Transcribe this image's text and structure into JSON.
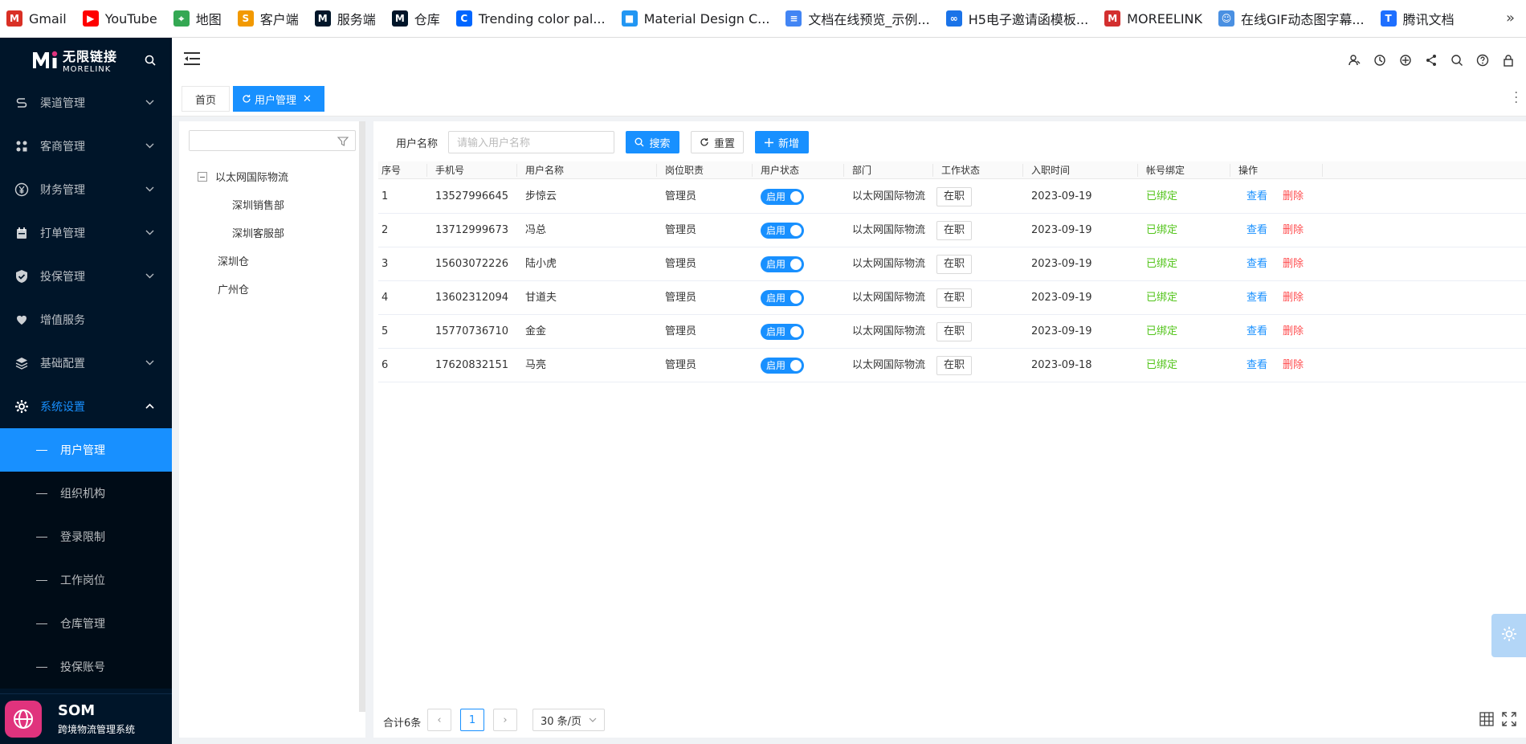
{
  "bookmarks": [
    {
      "label": "Gmail",
      "icon": "gmail-icon",
      "color": "#d93025",
      "glyph": "M"
    },
    {
      "label": "YouTube",
      "icon": "youtube-icon",
      "color": "#ff0000",
      "glyph": "▶"
    },
    {
      "label": "地图",
      "icon": "map-icon",
      "color": "#34a853",
      "glyph": "⌖"
    },
    {
      "label": "客户端",
      "icon": "client-icon",
      "color": "#f29900",
      "glyph": "S"
    },
    {
      "label": "服务端",
      "icon": "morelink-icon",
      "color": "#001529",
      "glyph": "M"
    },
    {
      "label": "仓库",
      "icon": "morelink-icon",
      "color": "#001529",
      "glyph": "M"
    },
    {
      "label": "Trending color pal...",
      "icon": "coolors-icon",
      "color": "#0066ff",
      "glyph": "C"
    },
    {
      "label": "Material Design C...",
      "icon": "material-icon",
      "color": "#2196f3",
      "glyph": "■"
    },
    {
      "label": "文档在线预览_示例...",
      "icon": "document-icon",
      "color": "#4285f4",
      "glyph": "≡"
    },
    {
      "label": "H5电子邀请函模板...",
      "icon": "h5-icon",
      "color": "#1a73e8",
      "glyph": "∞"
    },
    {
      "label": "MOREELINK",
      "icon": "morelink-red-icon",
      "color": "#d32f2f",
      "glyph": "M"
    },
    {
      "label": "在线GIF动态图字幕...",
      "icon": "gif-icon",
      "color": "#4a90e2",
      "glyph": "☺"
    },
    {
      "label": "腾讯文档",
      "icon": "tencent-docs-icon",
      "color": "#1e6fff",
      "glyph": "T"
    }
  ],
  "bookmarks_more": "»",
  "logo": {
    "cn": "无限链接",
    "en": "MORELINK",
    "mark": "M"
  },
  "menu": [
    {
      "label": "渠道管理",
      "icon": "channel-icon",
      "expanded": false
    },
    {
      "label": "客商管理",
      "icon": "merchant-icon",
      "expanded": false
    },
    {
      "label": "财务管理",
      "icon": "finance-icon",
      "expanded": false
    },
    {
      "label": "打单管理",
      "icon": "print-order-icon",
      "expanded": false
    },
    {
      "label": "投保管理",
      "icon": "insurance-icon",
      "expanded": false
    },
    {
      "label": "增值服务",
      "icon": "value-added-icon",
      "expanded": null
    },
    {
      "label": "基础配置",
      "icon": "layers-icon",
      "expanded": false
    },
    {
      "label": "系统设置",
      "icon": "gear-icon",
      "expanded": true
    }
  ],
  "submenu": [
    {
      "label": "用户管理",
      "active": true
    },
    {
      "label": "组织机构",
      "active": false
    },
    {
      "label": "登录限制",
      "active": false
    },
    {
      "label": "工作岗位",
      "active": false
    },
    {
      "label": "仓库管理",
      "active": false
    },
    {
      "label": "投保账号",
      "active": false
    }
  ],
  "brand": {
    "title": "SOM",
    "subtitle": "跨境物流管理系统"
  },
  "tabs": [
    {
      "label": "首页",
      "active": false
    },
    {
      "label": "用户管理",
      "active": true
    }
  ],
  "tree": {
    "filter_placeholder": "",
    "nodes": [
      {
        "label": "以太网国际物流",
        "level": 0,
        "collapsible": true
      },
      {
        "label": "深圳销售部",
        "level": 1
      },
      {
        "label": "深圳客服部",
        "level": 1
      },
      {
        "label": "深圳仓",
        "level": 0
      },
      {
        "label": "广州仓",
        "level": 0
      }
    ]
  },
  "search": {
    "label": "用户名称",
    "placeholder": "请输入用户名称",
    "value": "",
    "search_btn": "搜索",
    "reset_btn": "重置",
    "add_btn": "新增"
  },
  "table": {
    "columns": [
      "序号",
      "手机号",
      "用户名称",
      "岗位职责",
      "用户状态",
      "部门",
      "工作状态",
      "入职时间",
      "帐号绑定",
      "操作"
    ],
    "rows": [
      {
        "no": "1",
        "phone": "13527996645",
        "name": "步惊云",
        "role": "管理员",
        "status": "启用",
        "dept": "以太网国际物流",
        "work": "在职",
        "date": "2023-09-19",
        "bind": "已绑定"
      },
      {
        "no": "2",
        "phone": "13712999673",
        "name": "冯总",
        "role": "管理员",
        "status": "启用",
        "dept": "以太网国际物流",
        "work": "在职",
        "date": "2023-09-19",
        "bind": "已绑定"
      },
      {
        "no": "3",
        "phone": "15603072226",
        "name": "陆小虎",
        "role": "管理员",
        "status": "启用",
        "dept": "以太网国际物流",
        "work": "在职",
        "date": "2023-09-19",
        "bind": "已绑定"
      },
      {
        "no": "4",
        "phone": "13602312094",
        "name": "甘道夫",
        "role": "管理员",
        "status": "启用",
        "dept": "以太网国际物流",
        "work": "在职",
        "date": "2023-09-19",
        "bind": "已绑定"
      },
      {
        "no": "5",
        "phone": "15770736710",
        "name": "金金",
        "role": "管理员",
        "status": "启用",
        "dept": "以太网国际物流",
        "work": "在职",
        "date": "2023-09-19",
        "bind": "已绑定"
      },
      {
        "no": "6",
        "phone": "17620832151",
        "name": "马亮",
        "role": "管理员",
        "status": "启用",
        "dept": "以太网国际物流",
        "work": "在职",
        "date": "2023-09-18",
        "bind": "已绑定"
      }
    ],
    "action_view": "查看",
    "action_delete": "删除"
  },
  "pagination": {
    "total": "合计6条",
    "current": "1",
    "page_size": "30 条/页"
  },
  "colors": {
    "primary": "#1890ff",
    "sidebar": "#001529",
    "danger": "#ff4d4f",
    "success": "#52c41a",
    "brand": "#e0337d"
  }
}
